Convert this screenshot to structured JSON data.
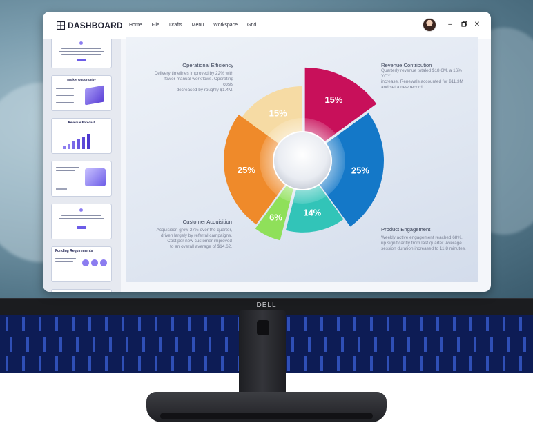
{
  "brand": "DELL",
  "app": {
    "logo_text": "DASHBOARD",
    "nav": [
      "Home",
      "File",
      "Drafts",
      "Menu",
      "Workspace",
      "Grid"
    ],
    "active_nav": "File",
    "window_controls": [
      "minimize-icon",
      "restore-icon",
      "close-icon"
    ]
  },
  "sidebar": {
    "thumbnails": [
      {
        "title": ""
      },
      {
        "title": "Market Opportunity"
      },
      {
        "title": "Revenue Forecast"
      },
      {
        "title": ""
      },
      {
        "title": ""
      },
      {
        "title": "Funding Requirements"
      },
      {
        "title": ""
      }
    ]
  },
  "chart_data": {
    "type": "pie",
    "categories": [
      "Revenue Contribution",
      "Product Engagement",
      "Customer Acquisition",
      "Operational Efficiency"
    ],
    "slices": [
      {
        "label": "15%",
        "value": 15,
        "color": "#c8105a"
      },
      {
        "label": "25%",
        "value": 25,
        "color": "#1478c8"
      },
      {
        "label": "14%",
        "value": 14,
        "color": "#32c4b8"
      },
      {
        "label": "6%",
        "value": 6,
        "color": "#8fe05a"
      },
      {
        "label": "25%",
        "value": 25,
        "color": "#ef8a2a"
      },
      {
        "label": "15%",
        "value": 15,
        "color": "#f6dba4"
      }
    ]
  },
  "annotations": {
    "operational": {
      "title": "Operational Efficiency",
      "body": [
        "Delivery timelines improved by 22% with",
        "fewer manual workflows. Operating costs",
        "decreased by roughly $1.4M."
      ]
    },
    "revenue": {
      "title": "Revenue Contribution",
      "body": [
        "Quarterly revenue totaled $18.6M, a 16% YOY",
        "increase. Renewals accounted for $11.3M",
        "and set a new record."
      ]
    },
    "customer": {
      "title": "Customer Acquisition",
      "body": [
        "Acquisition grew 27% over the quarter,",
        "driven largely by referral campaigns.",
        "Cost per new customer improved",
        "to an overall average of $14.62."
      ]
    },
    "product": {
      "title": "Product Engagement",
      "body": [
        "Weekly active engagement reached 68%,",
        "up significantly from last quarter. Average",
        "session duration increased to 11.8 minutes."
      ]
    }
  }
}
